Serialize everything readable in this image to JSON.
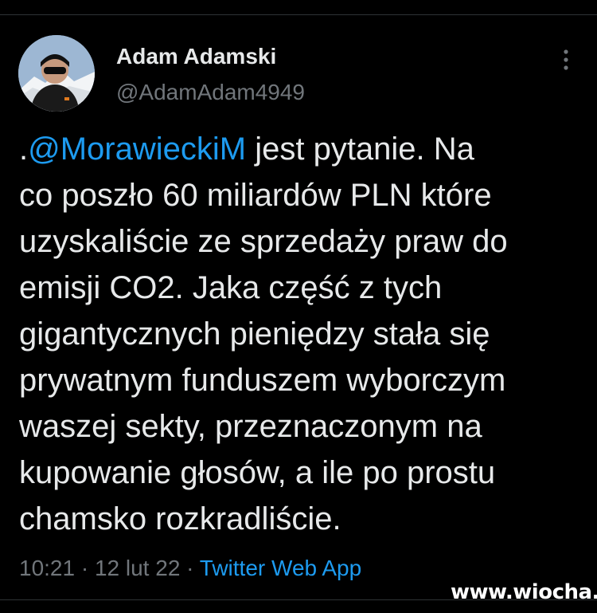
{
  "tweet": {
    "author_name": "Adam Adamski",
    "author_handle": "@AdamAdam4949",
    "text_prefix": ".",
    "mention": "@MorawieckiM",
    "text_body": " jest pytanie. Na\nco poszło 60 miliardów PLN które\nuzyskaliście ze sprzedaży praw do\nemisji CO2.  Jaka część z tych\ngigantycznych pieniędzy stała się\nprywatnym funduszem wyborczym\nwaszej sekty, przeznaczonym na\nkupowanie głosów, a ile po prostu\nchamsko rozkradliście.",
    "time": "10:21",
    "separator": "·",
    "date": "12 lut 22",
    "source": "Twitter Web App"
  },
  "watermark": {
    "text": "www.wiocha.pl"
  },
  "icons": {
    "more": "more-vertical-icon",
    "avatar": "avatar"
  },
  "colors": {
    "background": "#000000",
    "text": "#e7e9ea",
    "secondary": "#71767b",
    "accent": "#1d9bf0"
  }
}
